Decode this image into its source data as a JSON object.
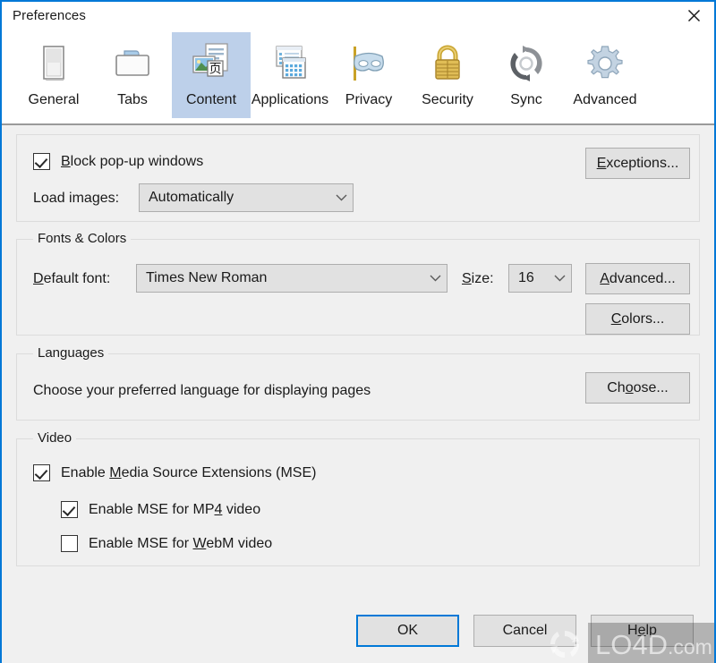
{
  "window": {
    "title": "Preferences",
    "close_icon": "close-icon",
    "accent_color": "#0078d7",
    "body_background": "#f0f0f0",
    "selected_tab_background": "#bdd0ea"
  },
  "tabs": [
    {
      "label": "General",
      "icon": "general-icon",
      "selected": false
    },
    {
      "label": "Tabs",
      "icon": "tabs-icon",
      "selected": false
    },
    {
      "label": "Content",
      "icon": "content-icon",
      "selected": true
    },
    {
      "label": "Applications",
      "icon": "applications-icon",
      "selected": false
    },
    {
      "label": "Privacy",
      "icon": "privacy-mask-icon",
      "selected": false
    },
    {
      "label": "Security",
      "icon": "padlock-icon",
      "selected": false
    },
    {
      "label": "Sync",
      "icon": "sync-arrows-icon",
      "selected": false
    },
    {
      "label": "Advanced",
      "icon": "gear-icon",
      "selected": false
    }
  ],
  "popups_group": {
    "block_popups": {
      "label_before": "",
      "accel": "B",
      "label_after": "lock pop-up windows",
      "checked": true
    },
    "load_images_label": "Load images:",
    "load_images_value": "Automatically",
    "load_images_options": [
      "Automatically"
    ],
    "exceptions_button": {
      "label_before": "",
      "accel": "E",
      "label_after": "xceptions..."
    }
  },
  "fonts_group": {
    "title": "Fonts & Colors",
    "default_font_label_before": "",
    "default_font_accel": "D",
    "default_font_label_after": "efault font:",
    "default_font_value": "Times New Roman",
    "default_font_options": [
      "Times New Roman"
    ],
    "size_label_before": "",
    "size_accel": "S",
    "size_label_after": "ize:",
    "size_value": "16",
    "size_options": [
      "16"
    ],
    "advanced_button": {
      "label_before": "",
      "accel": "A",
      "label_after": "dvanced..."
    },
    "colors_button": {
      "label_before": "",
      "accel": "C",
      "label_after": "olors..."
    }
  },
  "languages_group": {
    "title": "Languages",
    "description": "Choose your preferred language for displaying pages",
    "choose_button": {
      "label_before": "Ch",
      "accel": "o",
      "label_after": "ose..."
    }
  },
  "video_group": {
    "title": "Video",
    "items": [
      {
        "label_before": "Enable ",
        "accel": "M",
        "label_after": "edia Source Extensions (MSE)",
        "checked": true,
        "indent": false
      },
      {
        "label_before": "Enable MSE for MP",
        "accel": "4",
        "label_after": " video",
        "checked": true,
        "indent": true
      },
      {
        "label_before": "Enable MSE for ",
        "accel": "W",
        "label_after": "ebM video",
        "checked": false,
        "indent": true
      }
    ]
  },
  "footer": {
    "ok_label": "OK",
    "cancel_label": "Cancel",
    "help_label_before": "H",
    "help_accel": "e",
    "help_label_after": "lp"
  },
  "watermark": {
    "text": "LO4D",
    "suffix": ".com",
    "logo_icon": "circular-arrows-logo-icon"
  }
}
